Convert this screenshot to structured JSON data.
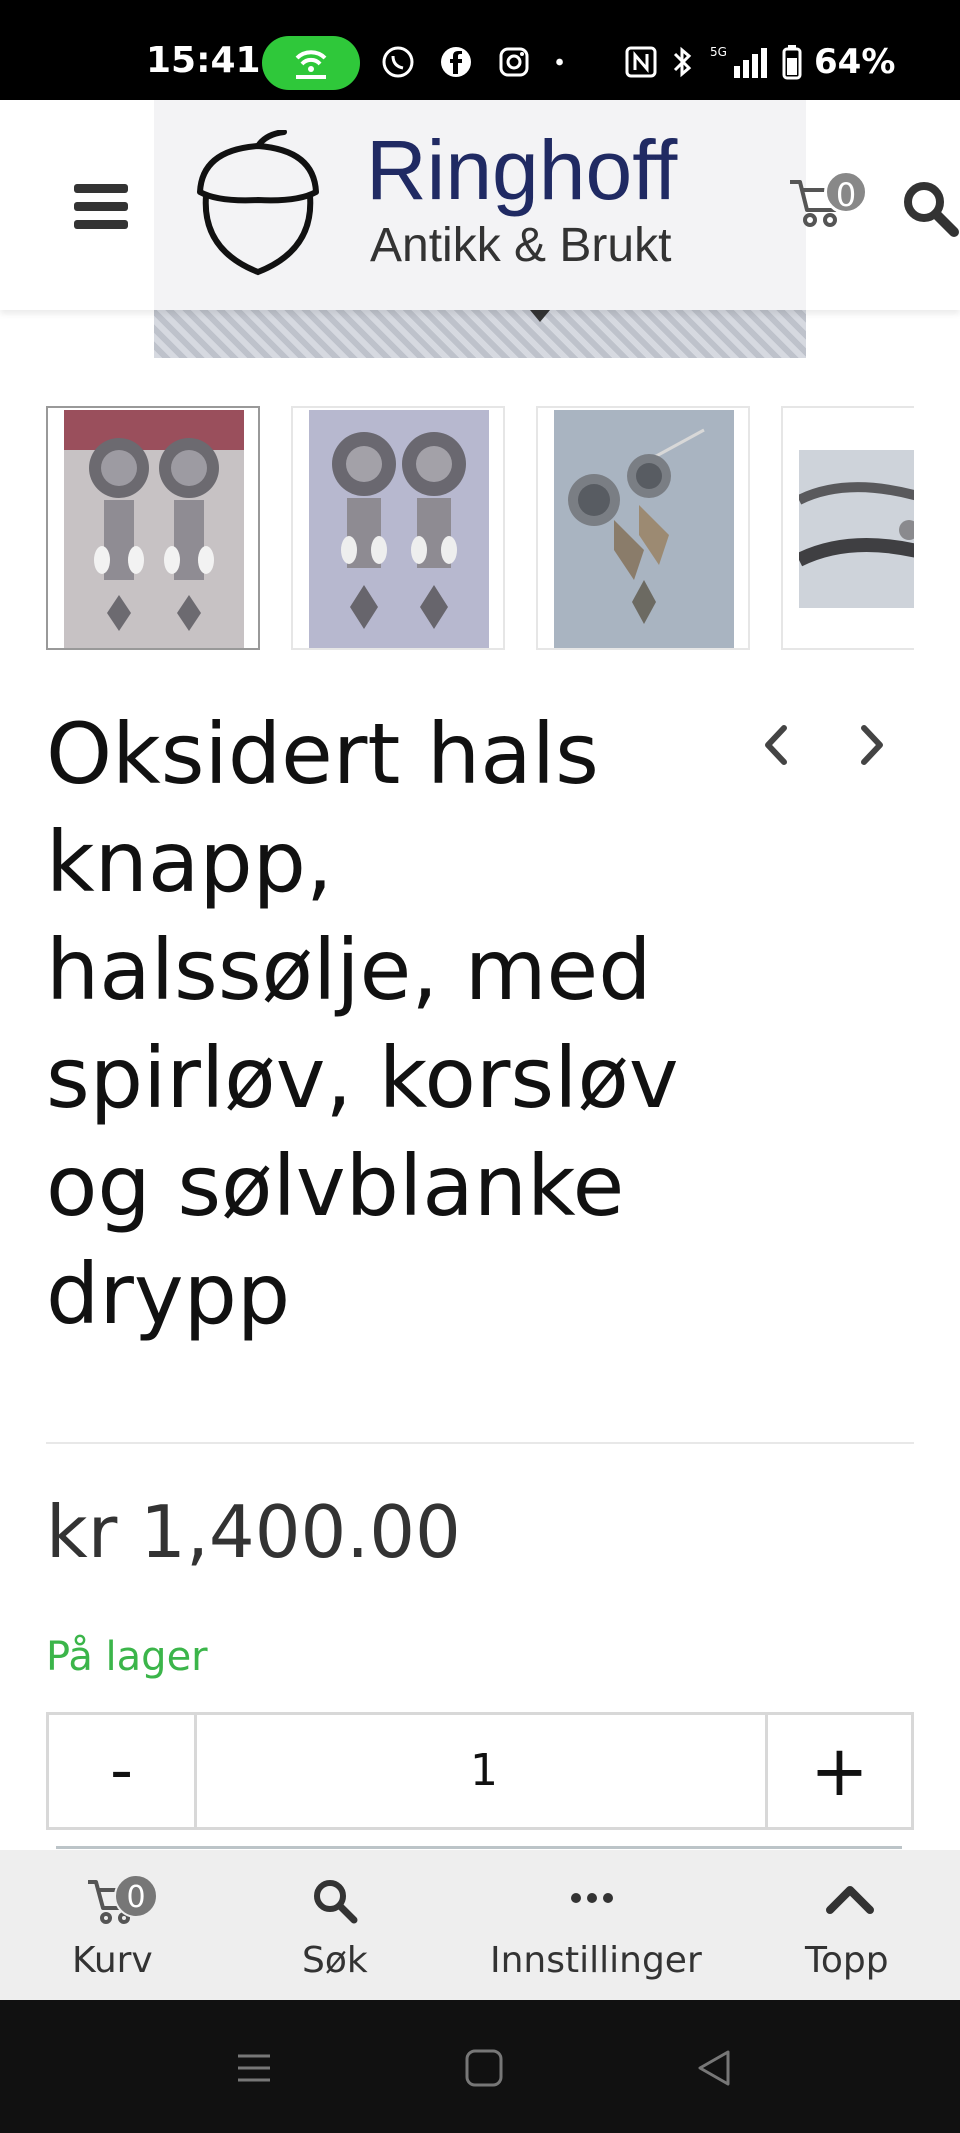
{
  "status_bar": {
    "time": "15:41",
    "battery_text": "64%",
    "network": "5G",
    "icons": [
      "hotspot-icon",
      "whatsapp-icon",
      "facebook-icon",
      "instagram-icon",
      "dot-icon",
      "nfc-icon",
      "bluetooth-icon",
      "signal-icon",
      "battery-icon"
    ]
  },
  "header": {
    "brand_name": "Ringhoff",
    "brand_tagline": "Antikk & Brukt",
    "cart_count": "0",
    "icons": [
      "menu-icon",
      "acorn-logo",
      "cart-icon",
      "search-icon"
    ]
  },
  "gallery": {
    "thumbnails": [
      "earrings-thumb-1",
      "earrings-thumb-2",
      "earrings-thumb-3",
      "brooch-thumb-4"
    ],
    "active_index": 0
  },
  "product": {
    "title": "Oksidert hals knapp, halssølje, med spirløv, korsløv og sølvblanke drypp",
    "price": "kr 1,400.00",
    "stock_status": "På lager",
    "quantity": "1",
    "minus_label": "-",
    "plus_label": "+"
  },
  "bottom_nav": {
    "items": [
      {
        "label": "Kurv",
        "icon": "cart-icon",
        "badge": "0"
      },
      {
        "label": "Søk",
        "icon": "search-icon"
      },
      {
        "label": "Innstillinger",
        "icon": "more-icon"
      },
      {
        "label": "Topp",
        "icon": "chevron-up-icon"
      }
    ]
  },
  "colors": {
    "brand_navy": "#202a63",
    "stock_green": "#3bb54a",
    "hotspot_green": "#2fc83a"
  }
}
